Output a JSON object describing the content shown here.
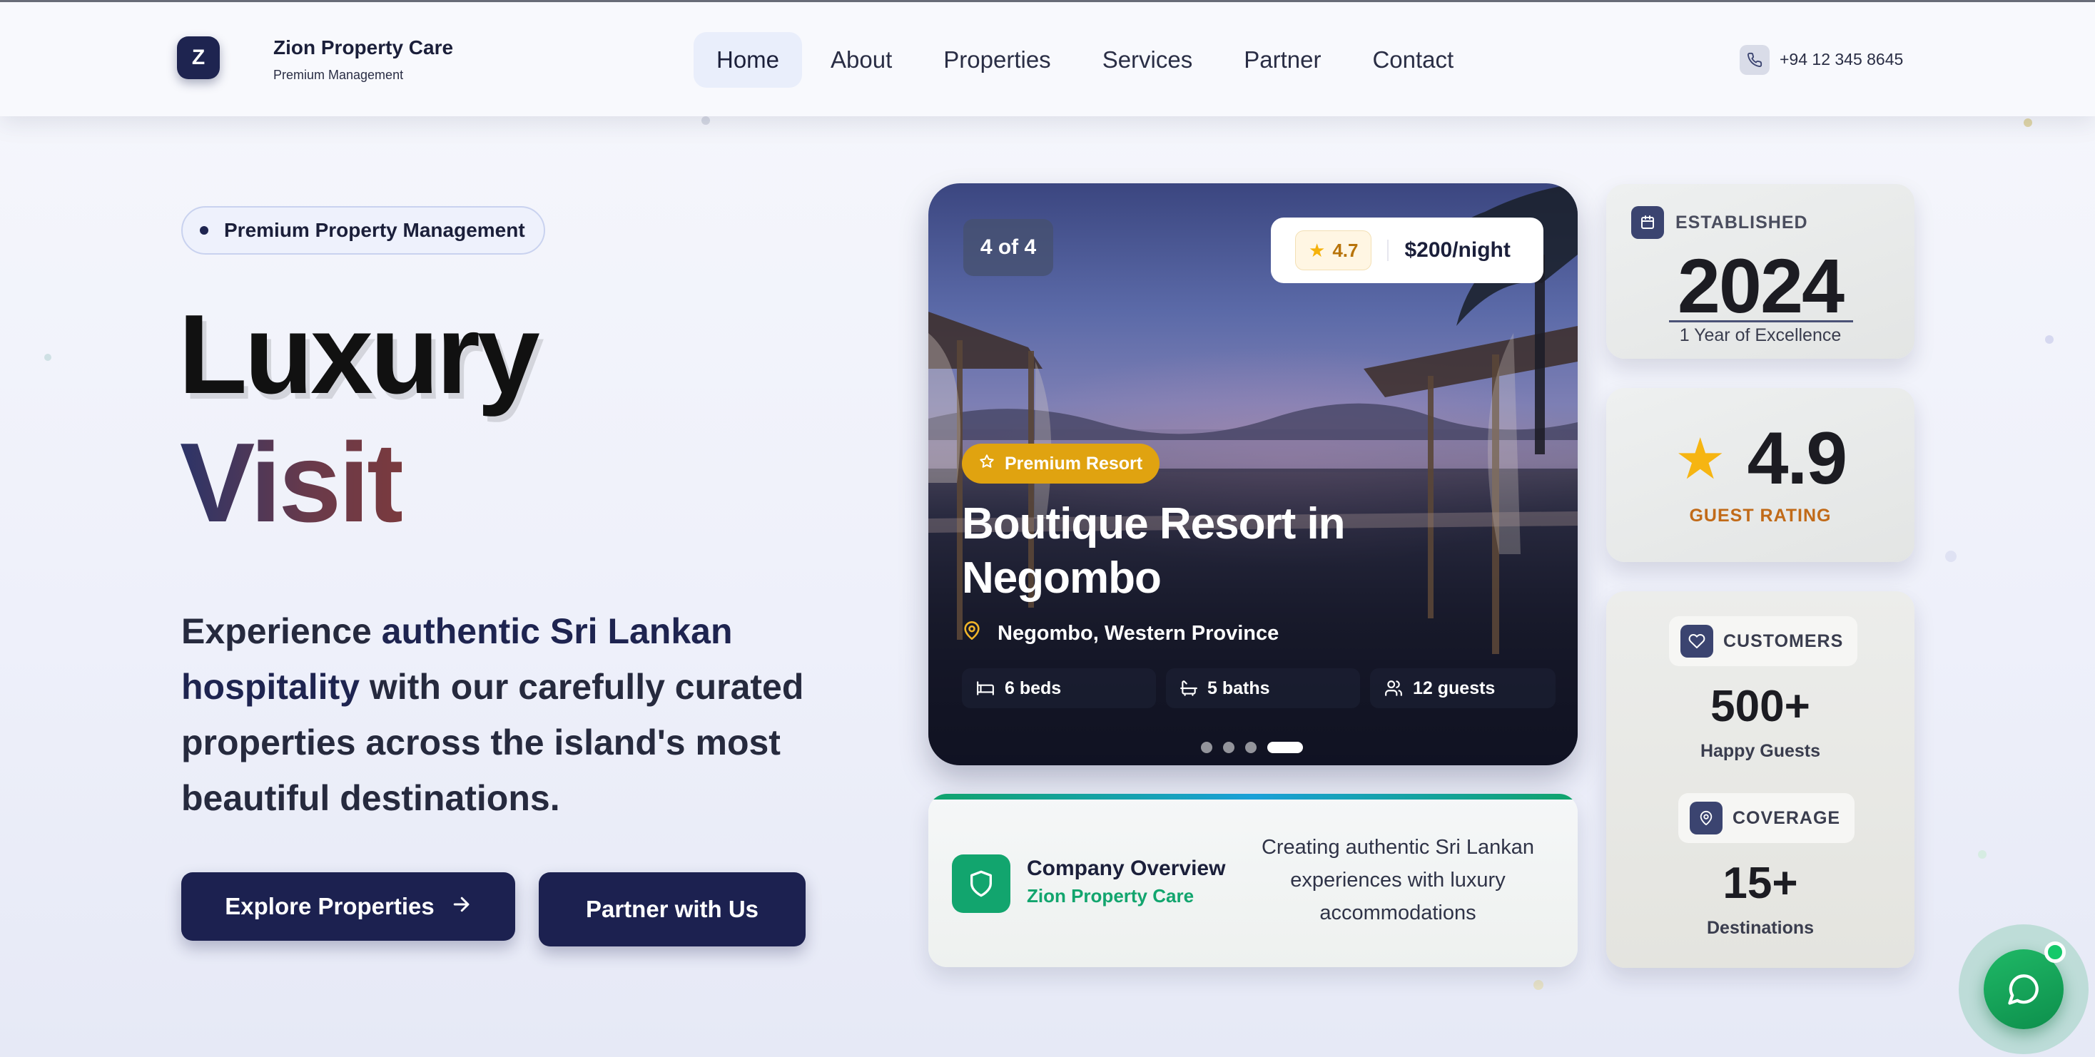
{
  "brand": {
    "initial": "Z",
    "name": "Zion Property Care",
    "tagline": "Premium Management"
  },
  "nav": {
    "items": [
      {
        "label": "Home",
        "active": true
      },
      {
        "label": "About",
        "active": false
      },
      {
        "label": "Properties",
        "active": false
      },
      {
        "label": "Services",
        "active": false
      },
      {
        "label": "Partner",
        "active": false
      },
      {
        "label": "Contact",
        "active": false
      }
    ],
    "phone": "+94 12 345 8645"
  },
  "hero": {
    "badge": "Premium Property Management",
    "title_line1": "Luxury",
    "title_line2": "Visit",
    "intro_before": "Experience ",
    "intro_highlight": "authentic Sri Lankan hospitality",
    "intro_after": " with our carefully curated properties across the island's most beautiful destinations.",
    "primary_button": "Explore Properties",
    "secondary_button": "Partner with Us"
  },
  "featured": {
    "counter": "4 of 4",
    "rating": "4.7",
    "price": "$200/night",
    "tag": "Premium Resort",
    "title": "Boutique Resort in Negombo",
    "location": "Negombo, Western Province",
    "beds": "6 beds",
    "baths": "5 baths",
    "guests": "12 guests",
    "slides_total": 4,
    "active_slide": 4
  },
  "overview": {
    "title": "Company Overview",
    "subtitle": "Zion Property Care",
    "text": "Creating authentic Sri Lankan experiences with luxury accommodations"
  },
  "stats": {
    "established_label": "ESTABLISHED",
    "established_year": "2024",
    "established_sub": "1 Year of Excellence",
    "rating_value": "4.9",
    "rating_label": "GUEST RATING",
    "customers_label": "CUSTOMERS",
    "customers_value": "500+",
    "customers_sub": "Happy Guests",
    "coverage_label": "COVERAGE",
    "coverage_value": "15+",
    "coverage_sub": "Destinations"
  },
  "colors": {
    "navy": "#1e2450",
    "accent_gold": "#e0a310",
    "accent_green": "#12a56e",
    "rating_orange": "#c16a18"
  },
  "icons": {
    "phone": "phone-icon",
    "arrow": "arrow-right-icon",
    "star": "star-icon",
    "location": "map-pin-icon",
    "bed": "bed-icon",
    "bath": "bath-icon",
    "guests": "users-icon",
    "shield": "shield-icon",
    "calendar": "calendar-icon",
    "heart": "heart-icon",
    "chat": "chat-icon"
  }
}
